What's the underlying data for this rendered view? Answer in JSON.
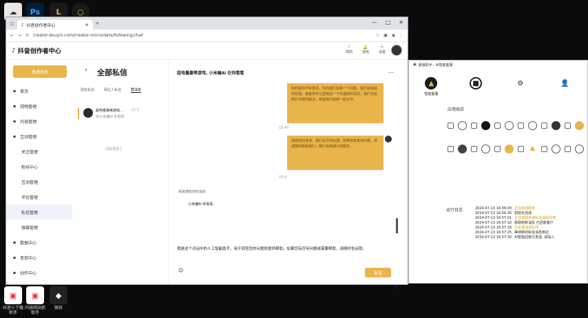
{
  "desktop": {
    "icons": [
      "",
      "Ps",
      "L",
      ""
    ],
    "bottom_labels": [
      "抖音小下载助手",
      "内容网站抓取手",
      "微技"
    ]
  },
  "browser": {
    "tab_title": "抖音创作者中心",
    "url": "creator.douyin.com/creator-micro/data/following/chat",
    "window_controls": [
      "—",
      "□",
      "✕"
    ]
  },
  "header": {
    "logo": "抖音创作者中心",
    "icons": [
      {
        "label": "帮助",
        "icon": "help-icon"
      },
      {
        "label": "通知",
        "icon": "bell-icon"
      },
      {
        "label": "设置",
        "icon": "tool-icon"
      }
    ]
  },
  "sidebar": {
    "publish_label": "高清发布",
    "items": [
      {
        "label": "首页",
        "sub": false,
        "active": false,
        "icon": "home-icon"
      },
      {
        "label": "视频管理",
        "sub": false,
        "active": false,
        "icon": "video-icon"
      },
      {
        "label": "内容管理",
        "sub": false,
        "active": false,
        "icon": "content-icon"
      },
      {
        "label": "互动管理",
        "sub": false,
        "active": true,
        "icon": "interact-icon"
      },
      {
        "label": "关注管理",
        "sub": true,
        "active": false
      },
      {
        "label": "粉丝中心",
        "sub": true,
        "active": false
      },
      {
        "label": "互动管理",
        "sub": true,
        "active": false
      },
      {
        "label": "评论管理",
        "sub": true,
        "active": false
      },
      {
        "label": "私信管理",
        "sub": true,
        "active": true
      },
      {
        "label": "弹幕管理",
        "sub": true,
        "active": false
      },
      {
        "label": "数据中心",
        "sub": false,
        "active": false,
        "icon": "data-icon"
      },
      {
        "label": "变现中心",
        "sub": false,
        "active": false,
        "icon": "money-icon"
      },
      {
        "label": "创作中心",
        "sub": false,
        "active": false,
        "icon": "create-icon"
      }
    ]
  },
  "messages": {
    "title": "全部私信",
    "tabs": [
      "朋友私信",
      "陌生人私信",
      "群消息"
    ],
    "conversation": {
      "name": "超电量暴等游戏...",
      "preview": "你小米编AI 你看你",
      "time": "22:1"
    },
    "no_more": "没有更多了"
  },
  "chat": {
    "title": "超电量暴等游戏, 小米编AI 在你看看",
    "bubble1": "有时候你不好意思，你向我们反映一下问题，我们就会给你处理，或者你可以直接说一下你遇到的情况，我们也会想办法帮你解决，希望我们能够一起合作。",
    "time1": "15:47",
    "bubble2": "感谢您的咨询，我们会尽快处理，如果您有其他问题，欢迎随时联系我们，我们会竭诚为您服务。",
    "time2": "15:5",
    "system_note": "系统通知你的消息",
    "system_sub": "小米编AI 你看看",
    "input_text": "我是这个对话中的人工智能助手，用于回答您的问题和提供帮助。如果您有任何问题或需要帮助，请随时告诉我。",
    "send_label": "发送"
  },
  "right_window": {
    "title": "超级助手 - AI智能客服",
    "top_icons": [
      {
        "label": "智能客服",
        "icon": "ai-icon"
      },
      {
        "label": "",
        "icon": "stop-icon"
      },
      {
        "label": "",
        "icon": "settings-icon"
      },
      {
        "label": "",
        "icon": "user-icon"
      }
    ],
    "store_title": "应用商店",
    "log_title": "运行日志",
    "logs": [
      {
        "time": "2024-07-13 16:56:03",
        "text": "正在启动服务",
        "color": "#d99a00"
      },
      {
        "time": "2024-07-13 16:56:30",
        "text": "初始化完成",
        "color": "#222"
      },
      {
        "time": "2024-07-13 16:57:01",
        "text": "正在获取未读私信消息列表",
        "color": "#d99a00"
      },
      {
        "time": "2024-07-13 16:57:10",
        "text": "获取到新消息 已回复客户",
        "color": "#222"
      },
      {
        "time": "2024-07-13 16:57:18",
        "text": "已处理消息队列",
        "color": "#d99a00"
      },
      {
        "time": "2024-07-13 16:57:25",
        "text": "等待新的私信消息到达",
        "color": "#222"
      },
      {
        "time": "2024-07-13 16:57:30",
        "text": "AI智能回复已发送, 请加入",
        "color": "#222"
      }
    ]
  },
  "colors": {
    "accent": "#e9b44c",
    "dark": "#111111"
  }
}
